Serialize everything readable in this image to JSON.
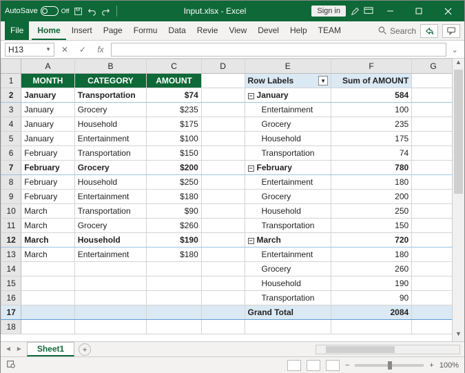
{
  "titlebar": {
    "autosave_label": "AutoSave",
    "autosave_state": "Off",
    "filename": "Input.xlsx - Excel",
    "signin": "Sign in"
  },
  "ribbon": {
    "tabs": [
      "File",
      "Home",
      "Insert",
      "Page",
      "Formu",
      "Data",
      "Revie",
      "View",
      "Devel",
      "Help",
      "TEAM"
    ],
    "search": "Search"
  },
  "formula": {
    "namebox": "H13",
    "fx": "fx",
    "value": ""
  },
  "columns": [
    "A",
    "B",
    "C",
    "D",
    "E",
    "F",
    "G"
  ],
  "headers": {
    "month": "MONTH",
    "category": "CATEGORY",
    "amount": "AMOUNT"
  },
  "rows": [
    {
      "r": "1"
    },
    {
      "r": "2",
      "month": "January",
      "category": "Transportation",
      "amount": "$74"
    },
    {
      "r": "3",
      "month": "January",
      "category": "Grocery",
      "amount": "$235"
    },
    {
      "r": "4",
      "month": "January",
      "category": "Household",
      "amount": "$175"
    },
    {
      "r": "5",
      "month": "January",
      "category": "Entertainment",
      "amount": "$100"
    },
    {
      "r": "6",
      "month": "February",
      "category": "Transportation",
      "amount": "$150"
    },
    {
      "r": "7",
      "month": "February",
      "category": "Grocery",
      "amount": "$200"
    },
    {
      "r": "8",
      "month": "February",
      "category": "Household",
      "amount": "$250"
    },
    {
      "r": "9",
      "month": "February",
      "category": "Entertainment",
      "amount": "$180"
    },
    {
      "r": "10",
      "month": "March",
      "category": "Transportation",
      "amount": "$90"
    },
    {
      "r": "11",
      "month": "March",
      "category": "Grocery",
      "amount": "$260"
    },
    {
      "r": "12",
      "month": "March",
      "category": "Household",
      "amount": "$190"
    },
    {
      "r": "13",
      "month": "March",
      "category": "Entertainment",
      "amount": "$180"
    },
    {
      "r": "14"
    },
    {
      "r": "15"
    },
    {
      "r": "16"
    },
    {
      "r": "17"
    },
    {
      "r": "18"
    }
  ],
  "pivot": {
    "row_labels": "Row Labels",
    "sum_label": "Sum of AMOUNT",
    "groups": [
      {
        "name": "January",
        "total": "584",
        "items": [
          {
            "k": "Entertainment",
            "v": "100"
          },
          {
            "k": "Grocery",
            "v": "235"
          },
          {
            "k": "Household",
            "v": "175"
          },
          {
            "k": "Transportation",
            "v": "74"
          }
        ]
      },
      {
        "name": "February",
        "total": "780",
        "items": [
          {
            "k": "Entertainment",
            "v": "180"
          },
          {
            "k": "Grocery",
            "v": "200"
          },
          {
            "k": "Household",
            "v": "250"
          },
          {
            "k": "Transportation",
            "v": "150"
          }
        ]
      },
      {
        "name": "March",
        "total": "720",
        "items": [
          {
            "k": "Entertainment",
            "v": "180"
          },
          {
            "k": "Grocery",
            "v": "260"
          },
          {
            "k": "Household",
            "v": "190"
          },
          {
            "k": "Transportation",
            "v": "90"
          }
        ]
      }
    ],
    "grand_label": "Grand Total",
    "grand_total": "2084"
  },
  "sheet_tab": "Sheet1",
  "status": {
    "ready_icon": "",
    "zoom": "100%"
  }
}
